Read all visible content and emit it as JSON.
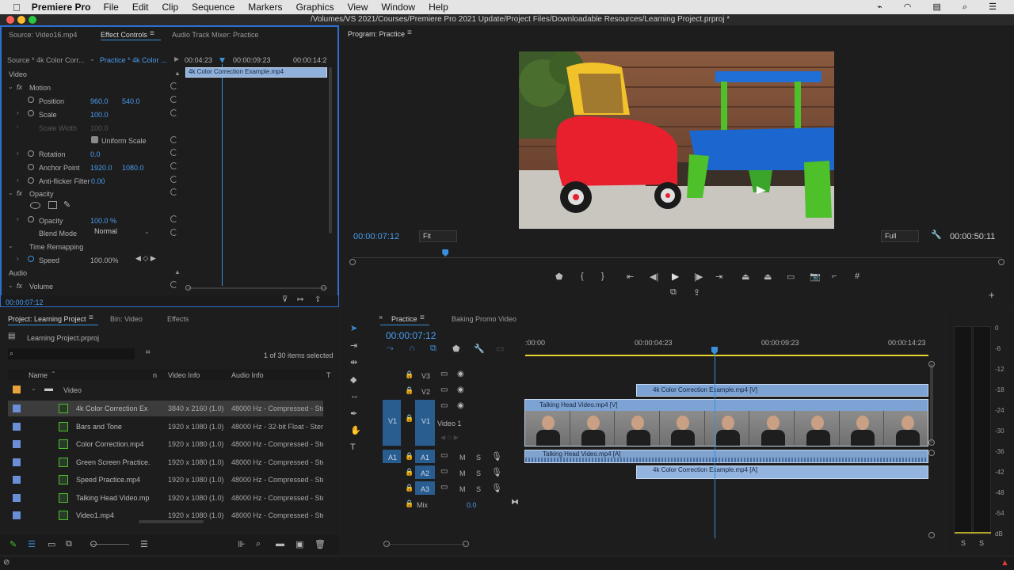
{
  "menubar": {
    "app_name": "Premiere Pro",
    "items": [
      "File",
      "Edit",
      "Clip",
      "Sequence",
      "Markers",
      "Graphics",
      "View",
      "Window",
      "Help"
    ]
  },
  "window": {
    "title": "/Volumes/VS 2021/Courses/Premiere Pro 2021 Update/Project Files/Downloadable Resources/Learning Project.prproj *"
  },
  "source_panel": {
    "tabs": [
      "Source: Video16.mp4",
      "Effect Controls",
      "Audio Track Mixer: Practice"
    ],
    "source_dropdown": "Source * 4k Color Corr...",
    "sequence_dropdown": "Practice * 4k Color ...",
    "ruler": [
      "00:04:23",
      "00:00:09:23",
      "00:00:14:2"
    ],
    "clip_label": "4k Color Correction Example.mp4",
    "section_video": "Video",
    "section_audio": "Audio",
    "motion": "Motion",
    "position": {
      "label": "Position",
      "x": "960.0",
      "y": "540.0"
    },
    "scale": {
      "label": "Scale",
      "value": "100.0"
    },
    "scale_width": {
      "label": "Scale Width",
      "value": "100.0"
    },
    "uniform_scale": "Uniform Scale",
    "rotation": {
      "label": "Rotation",
      "value": "0.0"
    },
    "anchor": {
      "label": "Anchor Point",
      "x": "1920.0",
      "y": "1080.0"
    },
    "antiflicker": {
      "label": "Anti-flicker Filter",
      "value": "0.00"
    },
    "opacity_section": "Opacity",
    "opacity": {
      "label": "Opacity",
      "value": "100.0 %"
    },
    "blend": {
      "label": "Blend Mode",
      "value": "Normal"
    },
    "time_remap": "Time Remapping",
    "speed": {
      "label": "Speed",
      "value": "100.00%"
    },
    "volume": "Volume",
    "timecode": "00:00:07:12"
  },
  "program": {
    "title": "Program: Practice",
    "timecode": "00:00:07:12",
    "fit": "Fit",
    "quality": "Full",
    "duration": "00:00:50:11",
    "playhead_fraction": 0.143
  },
  "project": {
    "tabs": [
      "Project: Learning Project",
      "Bin: Video",
      "Effects"
    ],
    "file": "Learning Project.prproj",
    "selected_count": "1 of 30 items selected",
    "columns": [
      "Name",
      "n",
      "Video Info",
      "Audio Info",
      "T"
    ],
    "bin": "Video",
    "items": [
      {
        "name": "4k Color Correction Ex",
        "video": "3840 x 2160 (1.0)",
        "audio": "48000 Hz - Compressed - Ste",
        "color": "#6b8fd6"
      },
      {
        "name": "Bars and Tone",
        "video": "1920 x 1080 (1.0)",
        "audio": "48000 Hz - 32-bit Float - Ster",
        "color": "#6b8fd6"
      },
      {
        "name": "Color Correction.mp4",
        "video": "1920 x 1080 (1.0)",
        "audio": "48000 Hz - Compressed - Ste",
        "color": "#6b8fd6"
      },
      {
        "name": "Green Screen Practice.",
        "video": "1920 x 1080 (1.0)",
        "audio": "48000 Hz - Compressed - Ste",
        "color": "#6b8fd6"
      },
      {
        "name": "Speed Practice.mp4",
        "video": "1920 x 1080 (1.0)",
        "audio": "48000 Hz - Compressed - Ste",
        "color": "#6b8fd6"
      },
      {
        "name": "Talking Head Video.mp",
        "video": "1920 x 1080 (1.0)",
        "audio": "48000 Hz - Compressed - Ste",
        "color": "#6b8fd6"
      },
      {
        "name": "Video1.mp4",
        "video": "1920 x 1080 (1.0)",
        "audio": "48000 Hz - Compressed - Ste",
        "color": "#6b8fd6"
      }
    ]
  },
  "timeline": {
    "tabs": [
      "Practice",
      "Baking Promo Video"
    ],
    "timecode": "00:00:07:12",
    "ruler": [
      ":00:00",
      "00:00:04:23",
      "00:00:09:23",
      "00:00:14:23"
    ],
    "tracks": {
      "v3": "V3",
      "v2": "V2",
      "v1": "V1",
      "v1_name": "Video 1",
      "v1_src": "V1",
      "a1": "A1",
      "a2": "A2",
      "a3": "A3",
      "a1_src": "A1",
      "m": "M",
      "s": "S",
      "mix": "Mix",
      "mix_val": "0.0"
    },
    "clips": {
      "v2": "4k Color Correction Example.mp4 [V]",
      "v1": "Talking Head Video.mp4 [V]",
      "a1": "Talking Head Video.mp4 [A]",
      "a2": "4k Color Correction Example.mp4 [A]"
    }
  },
  "meter": {
    "scale": [
      "0",
      "-6",
      "-12",
      "-18",
      "-24",
      "-30",
      "-36",
      "-42",
      "-48",
      "-54",
      "dB"
    ],
    "solo": [
      "S",
      "S"
    ]
  },
  "colors": {
    "accent": "#3b8fd9",
    "clip": "#7ca3d4",
    "orange_bin": "#e8a23a"
  }
}
